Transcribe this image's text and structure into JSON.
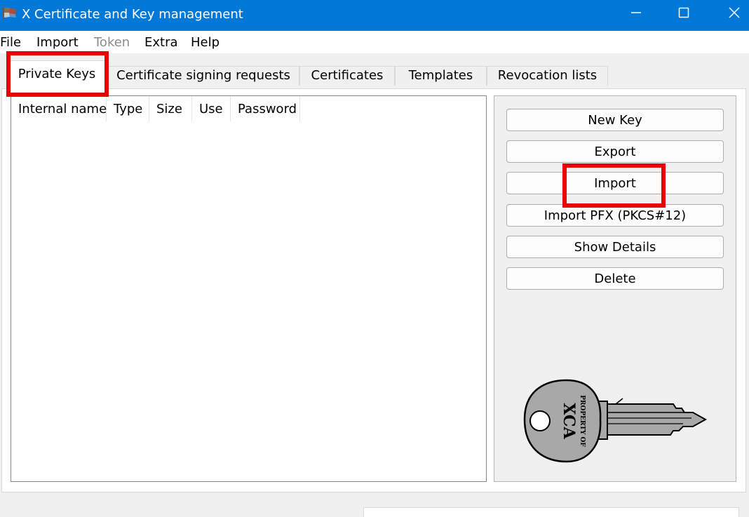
{
  "window": {
    "title": "X Certificate and Key management",
    "controls": {
      "minimize": "minimize-icon",
      "maximize": "maximize-icon",
      "close": "close-icon"
    }
  },
  "menu": {
    "items": [
      {
        "label": "File",
        "enabled": true
      },
      {
        "label": "Import",
        "enabled": true
      },
      {
        "label": "Token",
        "enabled": false
      },
      {
        "label": "Extra",
        "enabled": true
      },
      {
        "label": "Help",
        "enabled": true
      }
    ]
  },
  "tabs": [
    {
      "label": "Private Keys",
      "active": true
    },
    {
      "label": "Certificate signing requests",
      "active": false
    },
    {
      "label": "Certificates",
      "active": false
    },
    {
      "label": "Templates",
      "active": false
    },
    {
      "label": "Revocation lists",
      "active": false
    }
  ],
  "key_list": {
    "columns": [
      "Internal name",
      "Type",
      "Size",
      "Use",
      "Password"
    ],
    "sort_indicator": "^",
    "rows": []
  },
  "actions": {
    "new_key": "New Key",
    "export": "Export",
    "import": "Import",
    "import_pfx": "Import PFX (PKCS#12)",
    "show_details": "Show Details",
    "delete": "Delete"
  },
  "key_image": {
    "icon": "key-icon",
    "line1": "PROPERTY OF",
    "line2": "XCA"
  },
  "colors": {
    "titlebar": "#0078d7",
    "highlight": "#e60000",
    "disabled_text": "#8c8c8c"
  },
  "highlights": [
    {
      "target": "tab-private-keys"
    },
    {
      "target": "import-button"
    }
  ]
}
